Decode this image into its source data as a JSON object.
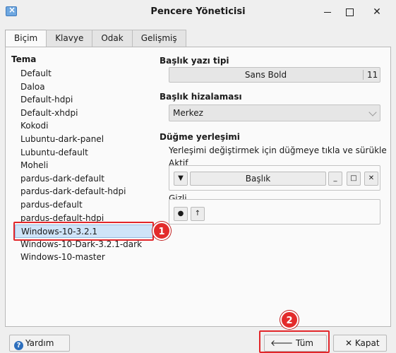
{
  "window": {
    "title": "Pencere Yöneticisi",
    "icon": "window-manager-icon"
  },
  "tabs": [
    {
      "label": "Biçim",
      "active": true
    },
    {
      "label": "Klavye",
      "active": false
    },
    {
      "label": "Odak",
      "active": false
    },
    {
      "label": "Gelişmiş",
      "active": false
    }
  ],
  "theme": {
    "title": "Tema",
    "items": [
      "Default",
      "Daloa",
      "Default-hdpi",
      "Default-xhdpi",
      "Kokodi",
      "Lubuntu-dark-panel",
      "Lubuntu-default",
      "Moheli",
      "pardus-dark-default",
      "pardus-dark-default-hdpi",
      "pardus-default",
      "pardus-default-hdpi",
      "Windows-10-3.2.1",
      "Windows-10-Dark-3.2.1-dark",
      "Windows-10-master"
    ],
    "selected": "Windows-10-3.2.1"
  },
  "title_font": {
    "label": "Başlık yazı tipi",
    "font": "Sans Bold",
    "size": "11"
  },
  "title_alignment": {
    "label": "Başlık hizalaması",
    "value": "Merkez"
  },
  "button_layout": {
    "label": "Düğme yerleşimi",
    "hint": "Yerleşimi değiştirmek için düğmeye tıkla ve sürükle",
    "active_label": "Aktif",
    "active_title_button": "Başlık",
    "hidden_label": "Gizli"
  },
  "footer": {
    "help": "Yardım",
    "all_settings": "Tüm Ayarlar",
    "close": "Kapat"
  },
  "callouts": [
    "1",
    "2"
  ],
  "colors": {
    "callout": "#e32b2b",
    "selection": "#cfe4f8",
    "help_icon": "#2d6fbd"
  }
}
